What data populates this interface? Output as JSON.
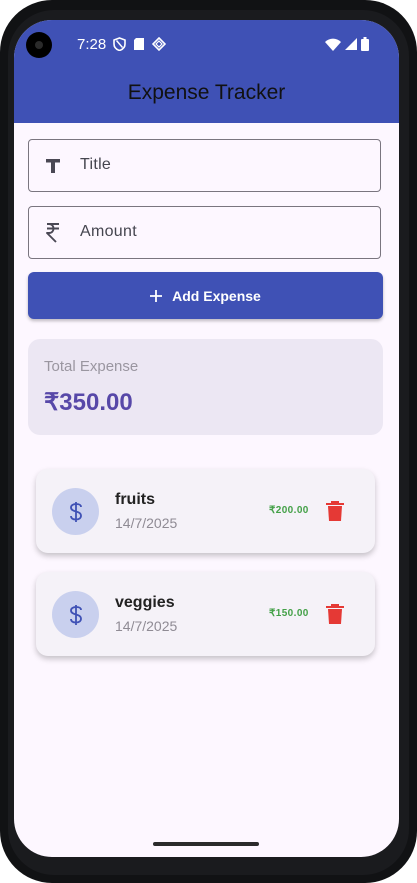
{
  "status_bar": {
    "time": "7:28"
  },
  "app_bar": {
    "title": "Expense Tracker"
  },
  "form": {
    "title_placeholder": "Title",
    "amount_placeholder": "Amount",
    "add_button_label": "Add Expense"
  },
  "summary": {
    "label": "Total Expense",
    "value": "₹350.00"
  },
  "expenses": [
    {
      "title": "fruits",
      "date": "14/7/2025",
      "amount": "₹200.00"
    },
    {
      "title": "veggies",
      "date": "14/7/2025",
      "amount": "₹150.00"
    }
  ],
  "colors": {
    "primary": "#3f51b5",
    "amount_green": "#43a047",
    "delete_red": "#e53935",
    "total_purple": "#5748a8"
  }
}
